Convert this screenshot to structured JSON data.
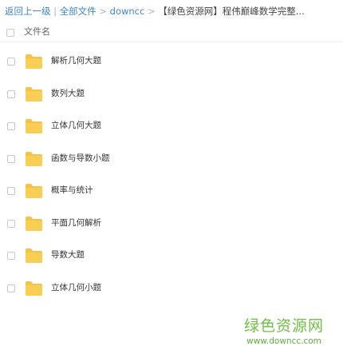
{
  "breadcrumb": {
    "back": "返回上一级",
    "divider": "|",
    "all_files": "全部文件",
    "arrow": ">",
    "level1": "downcc",
    "current": "【绿色资源网】程伟巅峰数学完整..."
  },
  "table": {
    "header_label": "文件名"
  },
  "files": [
    {
      "name": "解析几何大题",
      "icon": "folder-icon"
    },
    {
      "name": "数列大题",
      "icon": "folder-icon"
    },
    {
      "name": "立体几何大题",
      "icon": "folder-icon"
    },
    {
      "name": "函数与导数小题",
      "icon": "folder-icon"
    },
    {
      "name": "概率与统计",
      "icon": "folder-icon"
    },
    {
      "name": "平面几何解析",
      "icon": "folder-icon"
    },
    {
      "name": "导数大题",
      "icon": "folder-icon"
    },
    {
      "name": "立体几何小题",
      "icon": "folder-icon"
    }
  ],
  "watermark": {
    "title": "绿色资源网",
    "url": "www.downcc.com"
  },
  "colors": {
    "link": "#3d86d1",
    "folder": "#f5c346",
    "watermark": "#6fbf45"
  }
}
